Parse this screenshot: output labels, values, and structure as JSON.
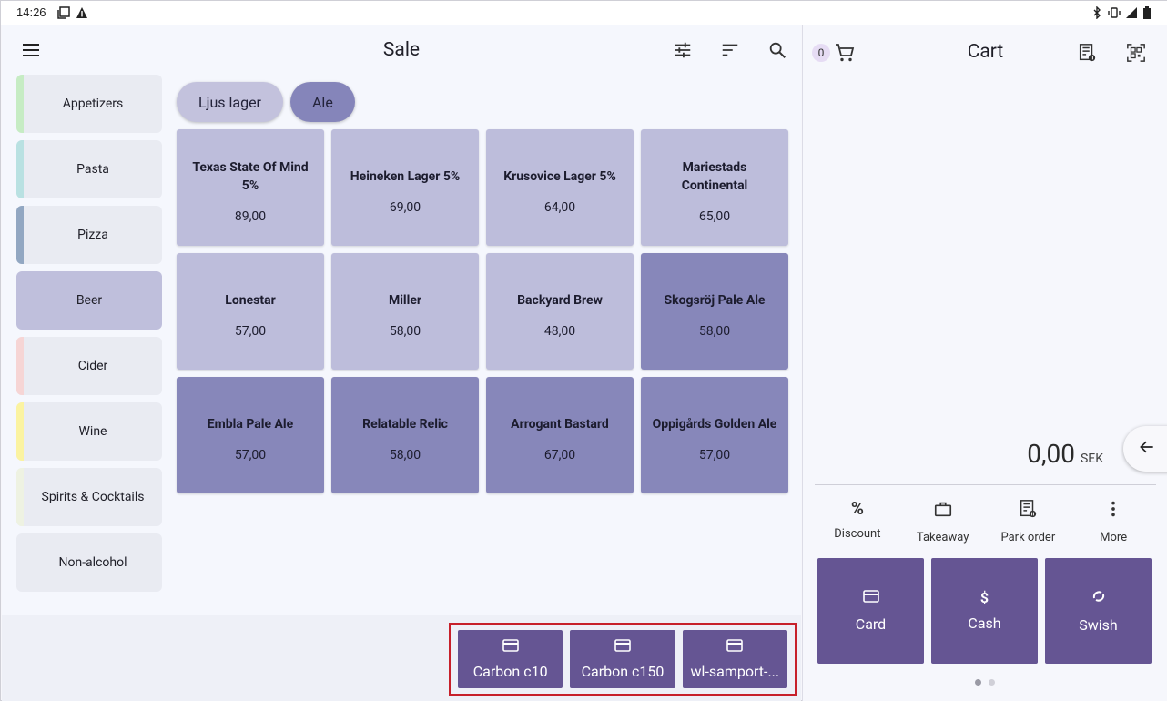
{
  "status_bar": {
    "time": "14:26",
    "left_icons": [
      "screenshot-icon",
      "warning-icon"
    ],
    "right_icons": [
      "bluetooth-icon",
      "vibrate-icon",
      "signal-icon",
      "battery-icon"
    ]
  },
  "header": {
    "title": "Sale",
    "icons": [
      "tune-icon",
      "sort-icon",
      "search-icon"
    ]
  },
  "categories": [
    {
      "label": "Appetizers",
      "color": "#c6ecc4",
      "active": false
    },
    {
      "label": "Pasta",
      "color": "#b9e1e2",
      "active": false
    },
    {
      "label": "Pizza",
      "color": "#92a7c2",
      "active": false
    },
    {
      "label": "Beer",
      "color": "#bfbfdc",
      "active": true
    },
    {
      "label": "Cider",
      "color": "#f6d5d5",
      "active": false
    },
    {
      "label": "Wine",
      "color": "#fbf3a1",
      "active": false
    },
    {
      "label": "Spirits & Cocktails",
      "color": "#eef2e2",
      "active": false
    },
    {
      "label": "Non-alcohol",
      "color": "#e9ebf2",
      "active": false
    }
  ],
  "subcategories": [
    {
      "label": "Ljus lager",
      "style": "light"
    },
    {
      "label": "Ale",
      "style": "dark"
    }
  ],
  "products": [
    {
      "name": "Texas State Of Mind 5%",
      "price": "89,00",
      "style": "light"
    },
    {
      "name": "Heineken Lager 5%",
      "price": "69,00",
      "style": "light"
    },
    {
      "name": "Krusovice Lager 5%",
      "price": "64,00",
      "style": "light"
    },
    {
      "name": "Mariestads Continental",
      "price": "65,00",
      "style": "light"
    },
    {
      "name": "Lonestar",
      "price": "57,00",
      "style": "light"
    },
    {
      "name": "Miller",
      "price": "58,00",
      "style": "light"
    },
    {
      "name": "Backyard Brew",
      "price": "48,00",
      "style": "light"
    },
    {
      "name": "Skogsröj Pale Ale",
      "price": "58,00",
      "style": "dark"
    },
    {
      "name": "Embla Pale Ale",
      "price": "57,00",
      "style": "dark"
    },
    {
      "name": "Relatable Relic",
      "price": "58,00",
      "style": "dark"
    },
    {
      "name": "Arrogant Bastard",
      "price": "67,00",
      "style": "dark"
    },
    {
      "name": "Oppigårds Golden Ale",
      "price": "57,00",
      "style": "dark"
    }
  ],
  "terminals": [
    {
      "label": "Carbon c10"
    },
    {
      "label": "Carbon c150"
    },
    {
      "label": "wl-samport-..."
    }
  ],
  "cart": {
    "title": "Cart",
    "count": "0",
    "total": "0,00",
    "currency": "SEK",
    "actions": [
      {
        "label": "Discount",
        "icon": "percent-icon"
      },
      {
        "label": "Takeaway",
        "icon": "briefcase-icon"
      },
      {
        "label": "Park order",
        "icon": "park-order-icon"
      },
      {
        "label": "More",
        "icon": "more-vert-icon"
      }
    ],
    "payments": [
      {
        "label": "Card",
        "icon": "card-icon"
      },
      {
        "label": "Cash",
        "icon": "dollar-icon"
      },
      {
        "label": "Swish",
        "icon": "swish-icon"
      }
    ]
  },
  "colors": {
    "accent": "#655593",
    "product_light": "#bdbddb",
    "product_dark": "#8787ba",
    "highlight_border": "#c7202a"
  }
}
